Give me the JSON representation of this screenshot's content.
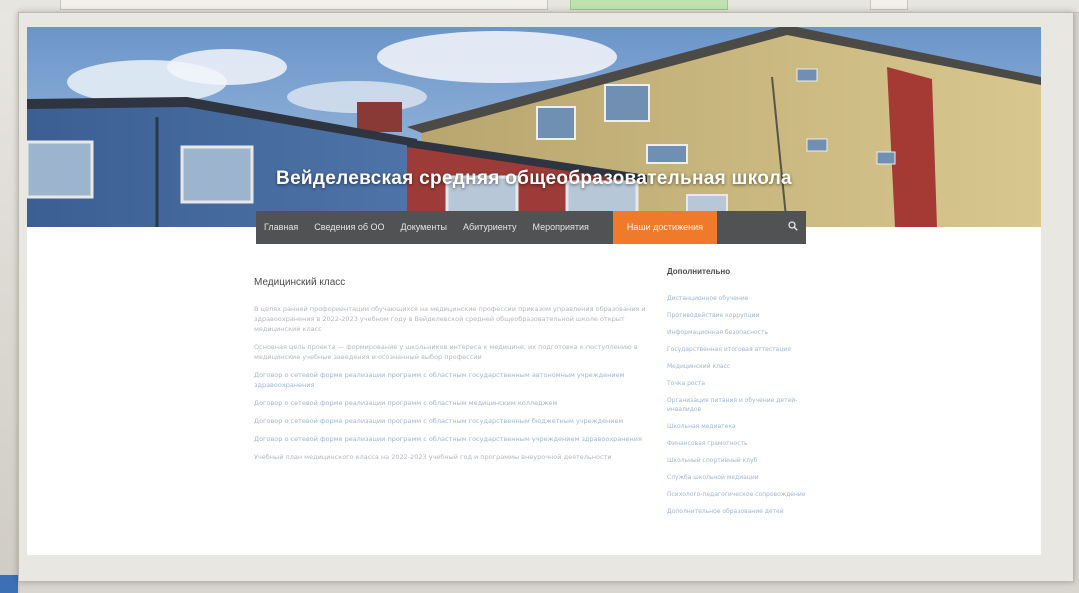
{
  "site": {
    "title": "Вейделевская средняя общеобразовательная школа"
  },
  "nav": {
    "items": [
      "Главная",
      "Сведения об ОО",
      "Документы",
      "Абитуриенту",
      "Мероприятия"
    ],
    "accent": "Наши достижения"
  },
  "article": {
    "heading": "Медицинский класс",
    "paragraphs": [
      {
        "text": "В целях ранней профориентации обучающихся на медицинские профессии приказом управления образования и здравоохранения в 2022-2023 учебном году в Вейделевской средней общеобразовательной школе открыт медицинский класс",
        "link": false
      },
      {
        "text": "Основная цель проекта — формирование у школьников интереса к медицине, их подготовка к поступлению в медицинские учебные заведения и осознанный выбор профессии",
        "link": false
      },
      {
        "text": "Договор о сетевой форме реализации программ с областным государственным автономным учреждением здравоохранения",
        "link": true
      },
      {
        "text": "Договор о сетевой форме реализации программ с областным медицинским колледжем",
        "link": true
      },
      {
        "text": "Договор о сетевой форме реализации программ с областным государственным бюджетным учреждением",
        "link": true
      },
      {
        "text": "Договор о сетевой форме реализации программ с областным государственным учреждением здравоохранения",
        "link": true
      },
      {
        "text": "Учебный план медицинского класса на 2022-2023 учебный год и программы внеурочной деятельности",
        "link": false
      }
    ]
  },
  "sidebar": {
    "heading": "Дополнительно",
    "links": [
      "Дистанционное обучение",
      "Противодействие коррупции",
      "Информационная безопасность",
      "Государственная итоговая аттестация",
      "Медицинский класс",
      "Точка роста",
      "Организация питания и обучение детей-инвалидов",
      "Школьная медиатека",
      "Финансовая грамотность",
      "Школьный спортивный клуб",
      "Служба школьной медиации",
      "Психолого-педагогическое сопровождение",
      "Дополнительное образование детей"
    ]
  },
  "colors": {
    "nav_bg": "#505254",
    "accent": "#f07a2c",
    "link": "#9fb6d0"
  }
}
